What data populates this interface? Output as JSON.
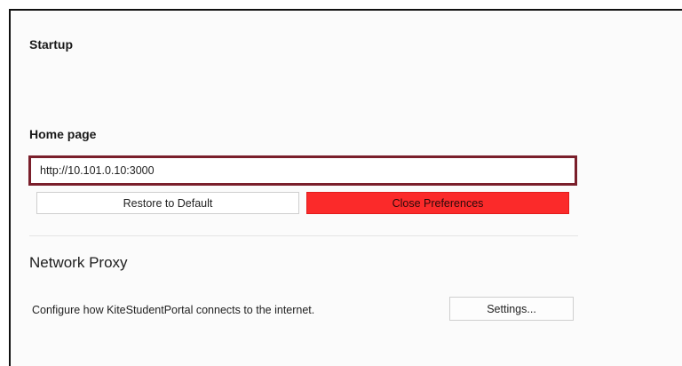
{
  "startup": {
    "title": "Startup"
  },
  "home_page": {
    "title": "Home page",
    "url_value": "http://10.101.0.10:3000",
    "restore_label": "Restore to Default",
    "close_label": "Close Preferences"
  },
  "network_proxy": {
    "title": "Network Proxy",
    "description": "Configure how KiteStudentPortal connects to the internet.",
    "settings_label": "Settings..."
  },
  "colors": {
    "highlight_border": "#7a1f2b",
    "close_button_bg": "#fb2a2a",
    "divider": "#e4e4e4"
  }
}
